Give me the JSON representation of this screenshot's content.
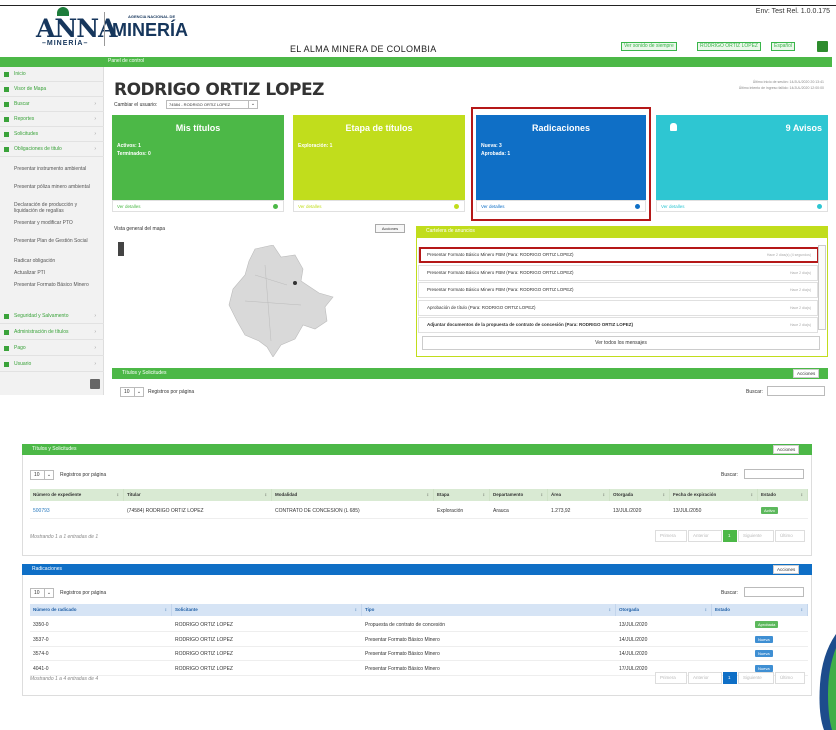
{
  "colors": {
    "green": "#4cb847",
    "lime": "#c1dd1c",
    "blue": "#0f6fc6",
    "cyan": "#2ec6d2",
    "red_highlight": "#b51818",
    "badge_green": "#5cb85c",
    "badge_blue": "#3f8fd3"
  },
  "header": {
    "logo_anna": "ANNA",
    "logo_anna_sub": "–MINERÍA–",
    "logo_mineria": "MINERÍA",
    "logo_agency": "AGENCIA NACIONAL DE",
    "tagline": "EL ALMA MINERA DE COLOMBIA",
    "env_label": "Env: Test Rel. 1.0.0.175",
    "btn_samples": "Ver sonido de siempre",
    "btn_user": "RODRIGO ORTIZ LOPEZ",
    "btn_lang": "Español"
  },
  "topbar": {
    "title": "Panel de control"
  },
  "sidebar": {
    "items": [
      {
        "label": "Inicio",
        "icon": "home-icon"
      },
      {
        "label": "Visor de Mapa",
        "icon": "map-pin-icon"
      },
      {
        "label": "Buscar",
        "icon": "search-icon"
      },
      {
        "label": "Reportes",
        "icon": "report-icon"
      },
      {
        "label": "Solicitudes",
        "icon": "list-icon"
      },
      {
        "label": "Obligaciones de titulo",
        "icon": "list-icon"
      }
    ],
    "subitems": [
      "Presentar instrumento ambiental",
      "Presentar póliza minero ambiental",
      "Declaración de producción y liquidación de regalías",
      "Presentar y modificar PTO",
      "Presentar Plan de Gestión Social",
      "Radicar obligación",
      "Actualizar PTI",
      "Presentar Formato Básico Minero"
    ],
    "items_bottom": [
      {
        "label": "Seguridad y Salvamento",
        "icon": "list-icon"
      },
      {
        "label": "Administración de títulos",
        "icon": "list-icon"
      },
      {
        "label": "Pago",
        "icon": "list-icon"
      },
      {
        "label": "Usuario",
        "icon": "user-icon"
      }
    ]
  },
  "user": {
    "name": "RODRIGO ORTIZ LOPEZ",
    "switch_label": "Cambiar el usuario:",
    "switch_value": "74584 - RODRIGO ORTIZ LOPEZ",
    "last_login_1": "Último inicio de sesión: 14/JUL/2020 20:13:41",
    "last_login_2": "Último intento de ingreso fallido: 14/JUL/2020 12:00:00"
  },
  "cards": {
    "titulos": {
      "title": "Mis títulos",
      "line1": "Activos: 1",
      "line2": "Terminados: 0",
      "footer": "Ver detalles"
    },
    "etapa": {
      "title": "Etapa de títulos",
      "line1": "Exploración: 1",
      "footer": "Ver detalles"
    },
    "radicaciones": {
      "title": "Radicaciones",
      "line1": "Nueva: 3",
      "line2": "Aprobada: 1",
      "footer": "Ver detalles"
    },
    "avisos": {
      "title": "9 Avisos",
      "footer": "Ver detalles"
    }
  },
  "map": {
    "title": "Vista general del mapa",
    "actions": "Acciones"
  },
  "notifications": {
    "title": "Cartelera de anuncios",
    "rows": [
      {
        "text": "Presentar Formato Básico Minero FBM (Para: RODRIGO ORTIZ LOPEZ)",
        "date": "Hace 2 días(s) (4 segundos)"
      },
      {
        "text": "Presentar Formato Básico Minero FBM (Para: RODRIGO ORTIZ LOPEZ)",
        "date": "Hace 2 día(s)"
      },
      {
        "text": "Presentar Formato Básico Minero FBM (Para: RODRIGO ORTIZ LOPEZ)",
        "date": "Hace 2 día(s)"
      },
      {
        "text": "Aprobación de título (Para: RODRIGO ORTIZ LOPEZ)",
        "date": "Hace 2 día(s)"
      },
      {
        "text": "Adjuntar documentos de la propuesta de contrato de concesión (Para: RODRIGO ORTIZ LOPEZ)",
        "date": "Hace 2 día(s)"
      }
    ],
    "see_all": "Ver todos los mensajes"
  },
  "mini_section": {
    "title": "Títulos y Solicitudes",
    "actions": "Acciones",
    "rpp_value": "10",
    "rpp_label": "Registros por página",
    "search_label": "Buscar:"
  },
  "titulos_table": {
    "title": "Títulos y Solicitudes",
    "actions": "Acciones",
    "rpp_value": "10",
    "rpp_label": "Registros por página",
    "search_label": "Buscar:",
    "columns": [
      "Número de expediente",
      "Titular",
      "Modalidad",
      "Etapa",
      "Departamento",
      "Área",
      "Otorgada",
      "Fecha de expiración",
      "Estado"
    ],
    "rows": [
      {
        "expediente": "500793",
        "titular": "(74584) RODRIGO ORTIZ LOPEZ",
        "modalidad": "CONTRATO DE CONCESION (L 685)",
        "etapa": "Exploración",
        "departamento": "Arauca",
        "area": "1.273,92",
        "otorgada": "13/JUL/2020",
        "expiracion": "13/JUL/2050",
        "estado": "Activo"
      }
    ],
    "showing": "Mostrando 1 a 1 entradas de 1",
    "pagination": [
      "Primera",
      "Anterior",
      "1",
      "Siguiente",
      "Último"
    ]
  },
  "radicaciones_table": {
    "title": "Radicaciones",
    "actions": "Acciones",
    "rpp_value": "10",
    "rpp_label": "Registros por página",
    "search_label": "Buscar:",
    "columns": [
      "Número de radicado",
      "Solicitante",
      "Tipo",
      "Otorgada",
      "Estado"
    ],
    "rows": [
      {
        "numero": "3350-0",
        "solicitante": "RODRIGO ORTIZ LOPEZ",
        "tipo": "Propuesta de contrato de concesión",
        "otorgada": "13/JUL/2020",
        "estado": "Aprobada"
      },
      {
        "numero": "3537-0",
        "solicitante": "RODRIGO ORTIZ LOPEZ",
        "tipo": "Presentar Formato Básico Minero",
        "otorgada": "14/JUL/2020",
        "estado": "Nueva"
      },
      {
        "numero": "3574-0",
        "solicitante": "RODRIGO ORTIZ LOPEZ",
        "tipo": "Presentar Formato Básico Minero",
        "otorgada": "14/JUL/2020",
        "estado": "Nueva"
      },
      {
        "numero": "4041-0",
        "solicitante": "RODRIGO ORTIZ LOPEZ",
        "tipo": "Presentar Formato Básico Minero",
        "otorgada": "17/JUL/2020",
        "estado": "Nueva"
      }
    ],
    "showing": "Mostrando 1 a 4 entradas de 4",
    "pagination": [
      "Primera",
      "Anterior",
      "1",
      "Siguiente",
      "Último"
    ]
  }
}
